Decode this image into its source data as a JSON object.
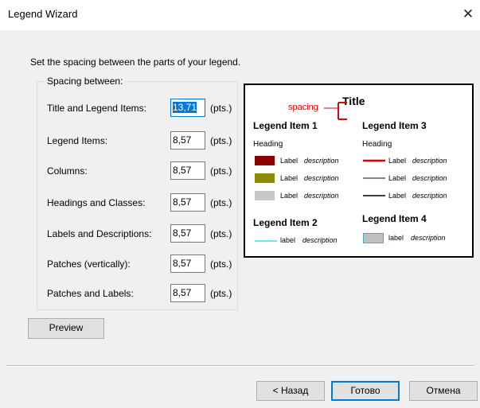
{
  "window": {
    "title": "Legend Wizard"
  },
  "instructions": "Set the spacing between the parts of your legend.",
  "group": {
    "title": "Spacing between:",
    "rows": [
      {
        "label": "Title and Legend Items:",
        "value": "13,71",
        "unit": "(pts.)"
      },
      {
        "label": "Legend Items:",
        "value": "8,57",
        "unit": "(pts.)"
      },
      {
        "label": "Columns:",
        "value": "8,57",
        "unit": "(pts.)"
      },
      {
        "label": "Headings and Classes:",
        "value": "8,57",
        "unit": "(pts.)"
      },
      {
        "label": "Labels and Descriptions:",
        "value": "8,57",
        "unit": "(pts.)"
      },
      {
        "label": "Patches (vertically):",
        "value": "8,57",
        "unit": "(pts.)"
      },
      {
        "label": "Patches and Labels:",
        "value": "8,57",
        "unit": "(pts.)"
      }
    ]
  },
  "buttons": {
    "preview": "Preview",
    "back": "< Назад",
    "finish": "Готово",
    "cancel": "Отмена"
  },
  "preview": {
    "title": "Title",
    "spacing_label": "spacing",
    "item1": {
      "heading": "Legend Item 1",
      "subheading": "Heading",
      "rows": [
        {
          "label": "Label",
          "desc": "description",
          "color": "#8b0000"
        },
        {
          "label": "Label",
          "desc": "description",
          "color": "#8b8b00"
        },
        {
          "label": "Label",
          "desc": "description",
          "color": "#c8c8c8"
        }
      ]
    },
    "item2": {
      "heading": "Legend Item 2",
      "label": "label",
      "desc": "description",
      "color": "#40e0e0"
    },
    "item3": {
      "heading": "Legend Item 3",
      "subheading": "Heading",
      "rows": [
        {
          "label": "Label",
          "desc": "description",
          "color": "#e00000"
        },
        {
          "label": "Label",
          "desc": "description",
          "color": "#000000"
        },
        {
          "label": "Label",
          "desc": "description",
          "color": "#000000"
        }
      ]
    },
    "item4": {
      "heading": "Legend Item 4",
      "label": "label",
      "desc": "description",
      "color": "#c0c0c0",
      "border": "#40b0c0"
    }
  }
}
